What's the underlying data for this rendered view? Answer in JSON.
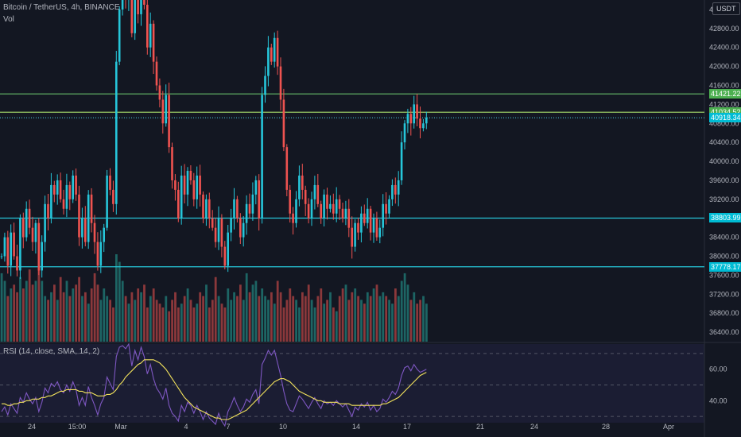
{
  "legend": {
    "symbol": "Bitcoin / TetherUS, 4h, BINANCE",
    "volume": "Vol",
    "rsi": "RSI (14, close, SMA, 14, 2)"
  },
  "currency_label": "USDT",
  "price_tags": [
    {
      "label": "41421.22",
      "value": 41421.22,
      "color": "#4caf50"
    },
    {
      "label": "41034.52",
      "value": 41034.52,
      "color": "#4caf50"
    },
    {
      "label": "40918.34",
      "value": 40918.34,
      "color": "#00bcd4"
    },
    {
      "label": "38803.99",
      "value": 38803.99,
      "color": "#00bcd4"
    },
    {
      "label": "37778.17",
      "value": 37778.17,
      "color": "#00bcd4"
    }
  ],
  "colors": {
    "background": "#131722",
    "candle_up": "#26c6da",
    "candle_down": "#ef5350",
    "volume_up": "#26a69a",
    "volume_down": "#ef5350",
    "line_green": "#66bb6a",
    "line_lime": "#9ccc65",
    "line_cyan": "#26c6da",
    "rsi_line": "#7e57c2",
    "rsi_ma": "#f2e25c"
  },
  "chart_data": [
    {
      "type": "candlestick",
      "title": "Bitcoin / TetherUS, 4h, BINANCE",
      "x_ticks": [
        "24",
        "15:00",
        "Mar",
        "4",
        "7",
        "10",
        "14",
        "17",
        "21",
        "24",
        "28",
        "Apr"
      ],
      "y_ticks": [
        36400,
        36800,
        37200,
        37600,
        38000,
        38400,
        38800,
        39200,
        39600,
        40000,
        40400,
        40800,
        41200,
        41600,
        42000,
        42400,
        42800,
        43200
      ],
      "ylim": [
        36200,
        43400
      ],
      "last_price": 40918.34,
      "horizontal_levels": [
        {
          "value": 41421.22,
          "color": "#66bb6a"
        },
        {
          "value": 41034.52,
          "color": "#9ccc65"
        },
        {
          "value": 38803.99,
          "color": "#26c6da"
        },
        {
          "value": 37778.17,
          "color": "#26c6da"
        }
      ],
      "closes": [
        38000,
        38400,
        37800,
        38500,
        38000,
        37700,
        38800,
        38400,
        39000,
        38600,
        38300,
        38700,
        37700,
        38300,
        39100,
        38800,
        39500,
        39300,
        39600,
        39200,
        39000,
        39500,
        39200,
        39700,
        39300,
        38400,
        38800,
        38300,
        39300,
        38700,
        38300,
        37800,
        38300,
        38600,
        39700,
        39400,
        39100,
        42100,
        43200,
        43500,
        43400,
        43800,
        42700,
        43600,
        43100,
        43800,
        43300,
        42400,
        42900,
        42100,
        41600,
        41300,
        40800,
        41400,
        40300,
        39600,
        39400,
        38800,
        39700,
        39300,
        39800,
        39600,
        39200,
        39700,
        39300,
        38800,
        39200,
        38800,
        38600,
        38300,
        38800,
        38200,
        37800,
        38500,
        38800,
        39200,
        38800,
        38400,
        38700,
        39100,
        38900,
        39300,
        39600,
        38800,
        41400,
        41800,
        42400,
        42100,
        42600,
        42000,
        41300,
        40300,
        39400,
        38900,
        38700,
        39200,
        39700,
        39400,
        39100,
        38800,
        39200,
        39500,
        39100,
        38800,
        39300,
        39000,
        39100,
        38900,
        39200,
        39000,
        38800,
        39000,
        38600,
        38200,
        38700,
        38500,
        38900,
        38700,
        39000,
        38500,
        38800,
        38400,
        38600,
        39100,
        38900,
        39200,
        39500,
        39300,
        39600,
        40400,
        40800,
        41000,
        40800,
        41200,
        40900,
        40700,
        40800,
        40918
      ]
    },
    {
      "type": "bar",
      "title": "Vol",
      "values": [
        180,
        160,
        120,
        140,
        150,
        130,
        170,
        140,
        160,
        190,
        150,
        160,
        200,
        160,
        120,
        110,
        130,
        150,
        110,
        170,
        130,
        160,
        120,
        140,
        150,
        170,
        120,
        130,
        100,
        140,
        180,
        150,
        110,
        140,
        120,
        110,
        90,
        230,
        210,
        160,
        120,
        100,
        130,
        110,
        140,
        130,
        150,
        90,
        120,
        140,
        110,
        100,
        90,
        120,
        80,
        110,
        130,
        90,
        100,
        120,
        140,
        110,
        90,
        100,
        130,
        120,
        150,
        90,
        110,
        170,
        120,
        100,
        90,
        140,
        110,
        130,
        120,
        150,
        110,
        180,
        130,
        150,
        160,
        120,
        140,
        120,
        110,
        130,
        100,
        160,
        130,
        90,
        110,
        140,
        120,
        110,
        90,
        130,
        120,
        150,
        110,
        90,
        120,
        140,
        100,
        110,
        130,
        90,
        80,
        120,
        140,
        150,
        110,
        130,
        140,
        120,
        110,
        100,
        130,
        120,
        140,
        150,
        120,
        130,
        120,
        110,
        100,
        140,
        120,
        160,
        180,
        150,
        110,
        130,
        100,
        110,
        120,
        100
      ]
    },
    {
      "type": "line",
      "title": "RSI (14, close, SMA, 14, 2)",
      "y_ticks": [
        40,
        60
      ],
      "ylim": [
        26,
        76
      ],
      "series": [
        {
          "values": [
            33,
            36,
            31,
            38,
            35,
            32,
            42,
            39,
            45,
            41,
            38,
            42,
            33,
            39,
            48,
            45,
            51,
            49,
            52,
            47,
            45,
            50,
            46,
            52,
            47,
            37,
            42,
            37,
            49,
            42,
            37,
            31,
            38,
            42,
            55,
            51,
            47,
            68,
            74,
            75,
            73,
            76,
            62,
            72,
            66,
            74,
            68,
            57,
            63,
            54,
            48,
            45,
            41,
            48,
            37,
            32,
            30,
            27,
            37,
            33,
            39,
            37,
            32,
            37,
            33,
            28,
            33,
            29,
            27,
            25,
            32,
            27,
            24,
            33,
            37,
            42,
            37,
            33,
            36,
            41,
            39,
            44,
            47,
            38,
            63,
            67,
            72,
            69,
            72,
            64,
            56,
            46,
            38,
            34,
            33,
            38,
            43,
            41,
            38,
            35,
            39,
            42,
            38,
            35,
            40,
            38,
            39,
            37,
            40,
            38,
            36,
            38,
            34,
            30,
            36,
            34,
            38,
            36,
            39,
            34,
            37,
            33,
            35,
            41,
            39,
            42,
            46,
            44,
            48,
            56,
            61,
            62,
            59,
            63,
            60,
            58,
            59,
            60
          ]
        },
        {
          "values": [
            38,
            38,
            37,
            37,
            38,
            38,
            39,
            39,
            40,
            40,
            41,
            41,
            41,
            42,
            42,
            43,
            43,
            44,
            45,
            46,
            46,
            47,
            47,
            47,
            47,
            46,
            46,
            45,
            45,
            45,
            44,
            43,
            43,
            43,
            44,
            44,
            45,
            47,
            50,
            52,
            55,
            57,
            59,
            61,
            63,
            64,
            66,
            66,
            66,
            66,
            65,
            64,
            62,
            60,
            57,
            54,
            51,
            48,
            45,
            42,
            40,
            38,
            36,
            35,
            34,
            33,
            32,
            31,
            30,
            29,
            29,
            28,
            28,
            28,
            29,
            30,
            31,
            32,
            33,
            34,
            36,
            38,
            40,
            42,
            44,
            46,
            48,
            50,
            52,
            53,
            54,
            54,
            53,
            52,
            50,
            48,
            46,
            45,
            44,
            43,
            42,
            41,
            40,
            40,
            39,
            39,
            39,
            39,
            39,
            38,
            38,
            38,
            38,
            37,
            37,
            37,
            37,
            37,
            37,
            37,
            37,
            37,
            37,
            38,
            38,
            39,
            40,
            41,
            42,
            44,
            46,
            48,
            50,
            52,
            54,
            56,
            57,
            58
          ]
        }
      ]
    }
  ],
  "x_axis_labels": [
    "24",
    "15:00",
    "Mar",
    "4",
    "7",
    "10",
    "14",
    "17",
    "21",
    "24",
    "28",
    "Apr"
  ],
  "price_axis_labels": [
    "36400.00",
    "36800.00",
    "37200.00",
    "37600.00",
    "38000.00",
    "38400.00",
    "38800.00",
    "39200.00",
    "39600.00",
    "40000.00",
    "40400.00",
    "40800.00",
    "41200.00",
    "41600.00",
    "42000.00",
    "42400.00",
    "42800.00",
    "43200.00"
  ],
  "rsi_axis_labels": [
    "40.00",
    "60.00"
  ]
}
